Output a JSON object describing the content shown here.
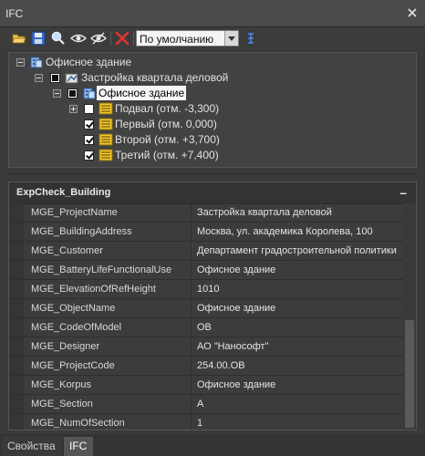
{
  "window": {
    "title": "IFC"
  },
  "toolbar": {
    "icons": [
      "open-folder-icon",
      "save-icon",
      "search-icon",
      "eye-icon",
      "eye-slash-icon",
      "delete-red-x-icon",
      "settings-lines-icon"
    ],
    "view_select": {
      "value": "По умолчанию"
    }
  },
  "tree": {
    "root": {
      "label": "Офисное здание"
    },
    "site": {
      "label": "Застройка квартала деловой"
    },
    "building": {
      "label": "Офисное здание"
    },
    "storeys": [
      {
        "label": "Подвал (отм. -3,300)",
        "checked": false,
        "expandable": true
      },
      {
        "label": "Первый (отм. 0,000)",
        "checked": true,
        "expandable": false
      },
      {
        "label": "Второй (отм. +3,700)",
        "checked": true,
        "expandable": false
      },
      {
        "label": "Третий (отм. +7,400)",
        "checked": true,
        "expandable": false
      }
    ]
  },
  "properties": {
    "group": "ExpCheck_Building",
    "collapse_symbol": "–",
    "rows": [
      {
        "key": "MGE_ProjectName",
        "value": "Застройка квартала деловой"
      },
      {
        "key": "MGE_BuildingAddress",
        "value": "Москва, ул. академика Королева, 100"
      },
      {
        "key": "MGE_Customer",
        "value": "Департамент градостроительной политики"
      },
      {
        "key": "MGE_BatteryLifeFunctionalUse",
        "value": "Офисное здание"
      },
      {
        "key": "MGE_ElevationOfRefHeight",
        "value": "1010"
      },
      {
        "key": "MGE_ObjectName",
        "value": "Офисное здание"
      },
      {
        "key": "MGE_CodeOfModel",
        "value": "OB"
      },
      {
        "key": "MGE_Designer",
        "value": "АО \"Нанософт\""
      },
      {
        "key": "MGE_ProjectCode",
        "value": "254.00.OB"
      },
      {
        "key": "MGE_Korpus",
        "value": "Офисное здание"
      },
      {
        "key": "MGE_Section",
        "value": "A"
      },
      {
        "key": "MGE_NumOfSection",
        "value": "1"
      }
    ]
  },
  "tabs": [
    {
      "label": "Свойства",
      "active": false
    },
    {
      "label": "IFC",
      "active": true
    }
  ]
}
